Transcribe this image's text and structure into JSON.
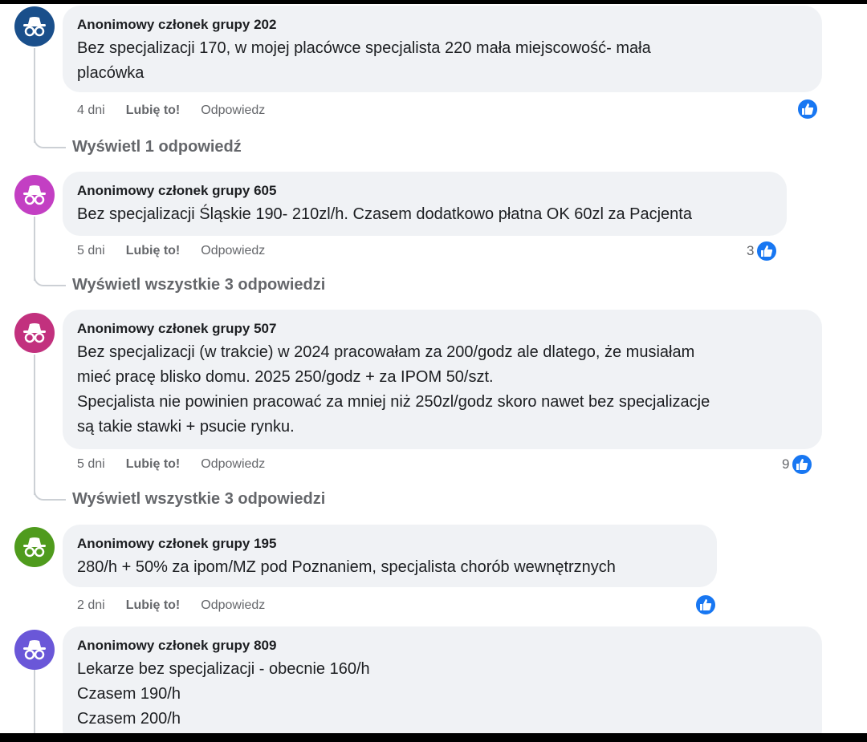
{
  "comments": [
    {
      "author": "Anonimowy członek grupy 202",
      "text": "Bez specjalizacji 170, w mojej placówce specjalista 220 mała miejscowość- mała\nplacówka",
      "time": "4 dni",
      "like_label": "Lubię to!",
      "reply_label": "Odpowiedz",
      "reaction_count": "",
      "view_replies": "Wyświetl 1 odpowiedź",
      "avatar_color": "#1a4f8b"
    },
    {
      "author": "Anonimowy członek grupy 605",
      "text": "Bez specjalizacji Śląskie 190- 210zl/h. Czasem dodatkowo płatna OK 60zl za Pacjenta",
      "time": "5 dni",
      "like_label": "Lubię to!",
      "reply_label": "Odpowiedz",
      "reaction_count": "3",
      "view_replies": "Wyświetl wszystkie 3 odpowiedzi",
      "avatar_color": "#c33fc3"
    },
    {
      "author": "Anonimowy członek grupy 507",
      "text": "Bez specjalizacji (w trakcie) w 2024 pracowałam za 200/godz ale dlatego, że musiałam\nmieć pracę blisko domu. 2025 250/godz + za IPOM 50/szt.\nSpecjalista nie powinien pracować za mniej niż 250zl/godz skoro nawet bez specjalizacje\nsą takie stawki + psucie rynku.",
      "time": "5 dni",
      "like_label": "Lubię to!",
      "reply_label": "Odpowiedz",
      "reaction_count": "9",
      "view_replies": "Wyświetl wszystkie 3 odpowiedzi",
      "avatar_color": "#c2317e"
    },
    {
      "author": "Anonimowy członek grupy 195",
      "text": "280/h + 50% za ipom/MZ pod Poznaniem, specjalista chorób wewnętrznych",
      "time": "2 dni",
      "like_label": "Lubię to!",
      "reply_label": "Odpowiedz",
      "reaction_count": "",
      "view_replies": "",
      "avatar_color": "#4f9b1d"
    },
    {
      "author": "Anonimowy członek grupy 809",
      "text": "Lekarze bez specjalizacji - obecnie 160/h\nCzasem 190/h\nCzasem 200/h",
      "time": "",
      "like_label": "",
      "reply_label": "",
      "reaction_count": "",
      "view_replies": "",
      "avatar_color": "#6a57d8"
    }
  ]
}
